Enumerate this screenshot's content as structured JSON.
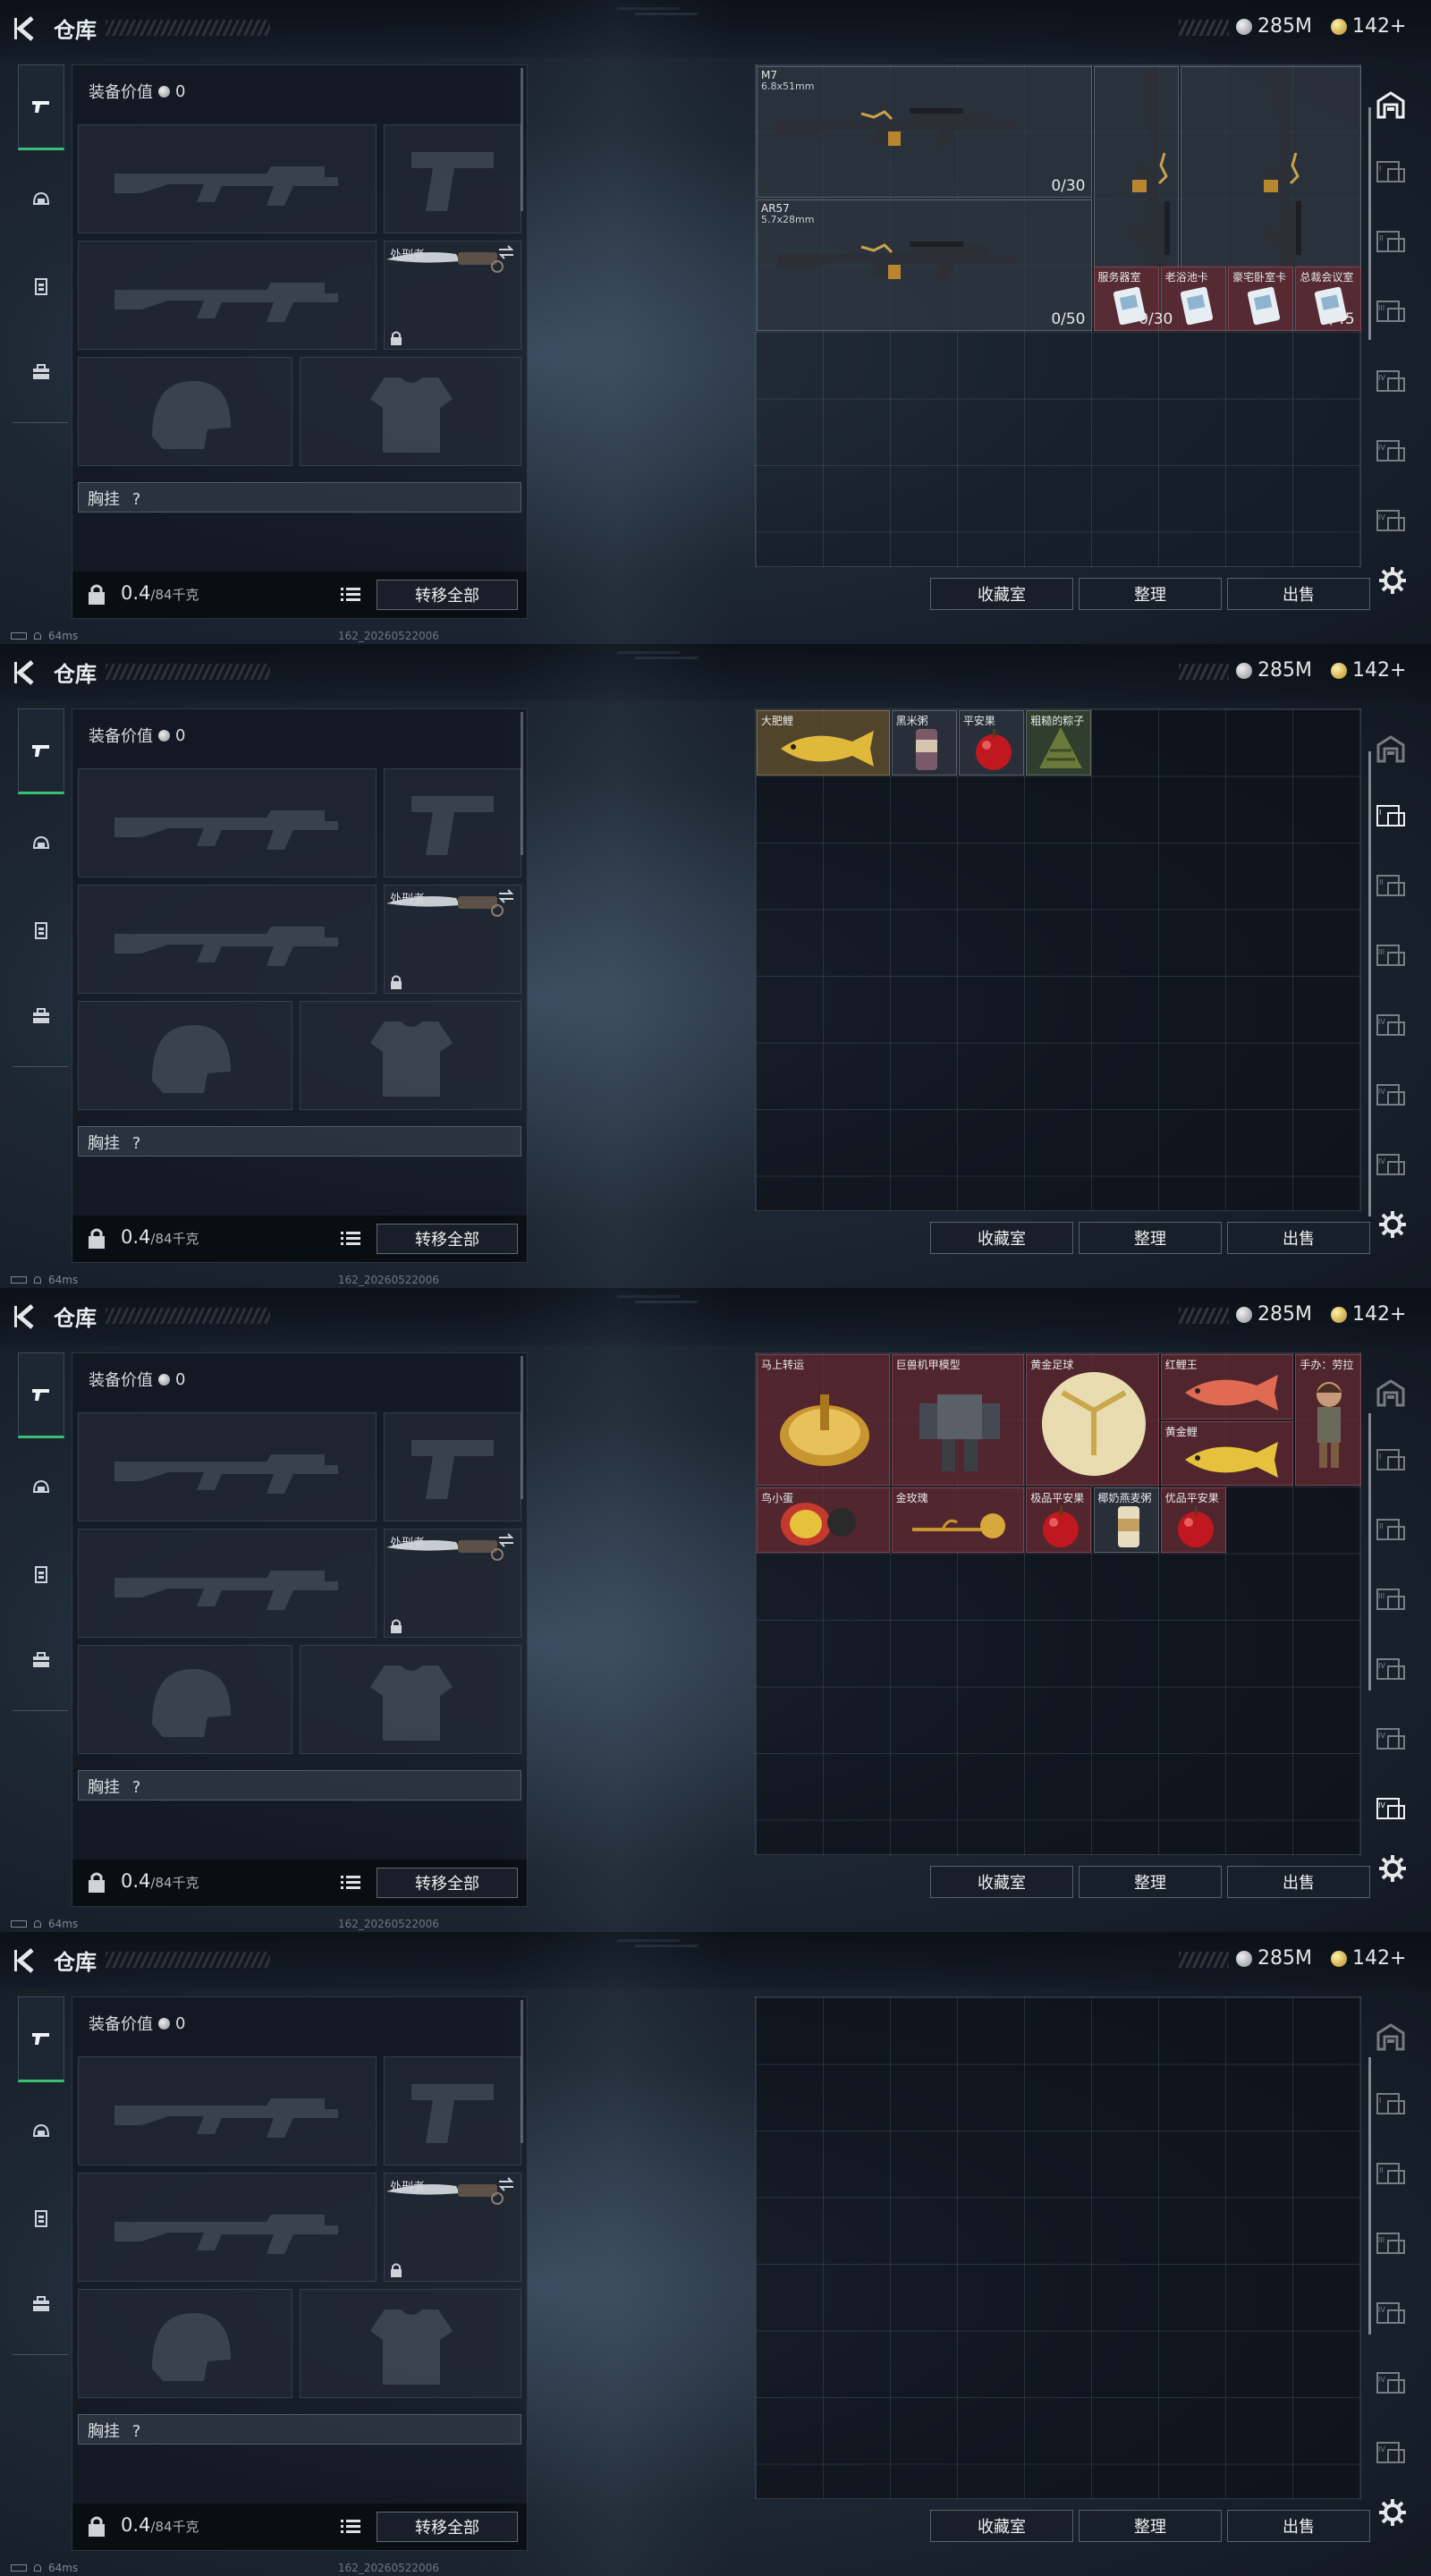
{
  "app": {
    "title": "仓库"
  },
  "currency": {
    "silver": "285M",
    "gold": "142+"
  },
  "equipment": {
    "value_label": "装备价值",
    "value": "0",
    "melee_name": "处刑者",
    "chest_rig_label": "胸挂",
    "chest_rig_hint": "?",
    "weight": "0.4",
    "weight_max": "/84千克",
    "transfer_all": "转移全部"
  },
  "buttons": {
    "collection": "收藏室",
    "organize": "整理",
    "sell": "出售"
  },
  "status": {
    "ping": "64ms",
    "build": "162_20260522006"
  },
  "screens": [
    {
      "weapons": [
        {
          "name": "M7",
          "caliber": "6.8x51mm",
          "count": "0/30"
        },
        {
          "name": "AR57",
          "caliber": "5.7x28mm",
          "count": "0/50"
        }
      ],
      "vertical_counts": [
        "0/30",
        "0/45"
      ],
      "cards": [
        "服务器室",
        "老浴池卡",
        "豪宅卧室卡",
        "总裁会议室"
      ]
    },
    {
      "items": [
        "大肥鲤",
        "黑米粥",
        "平安果",
        "粗糙的粽子"
      ]
    },
    {
      "items": [
        "马上转运",
        "巨兽机甲模型",
        "黄金足球",
        "红鲤王",
        "手办：劳拉",
        "黄金鲤",
        "鸟小蛋",
        "金玫瑰",
        "极品平安果",
        "椰奶燕麦粥",
        "优品平安果"
      ]
    },
    {
      "items": []
    }
  ]
}
